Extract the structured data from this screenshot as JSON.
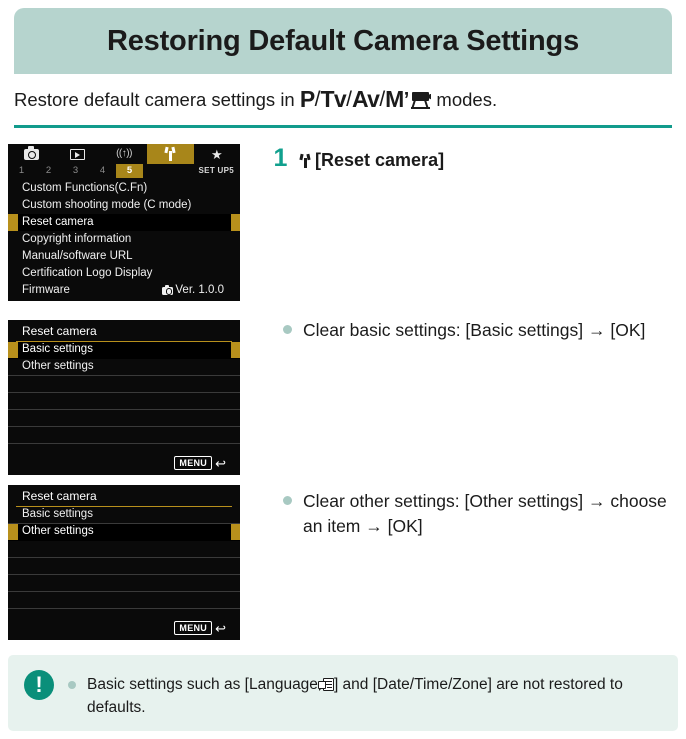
{
  "header": {
    "title": "Restoring Default Camera Settings"
  },
  "subtitle": {
    "prefix": "Restore default camera settings in ",
    "mode_p": "P",
    "mode_tv": "Tv",
    "mode_av": "Av",
    "mode_m": "M",
    "slash": "/",
    "apostrophe": "’",
    "movie_icon": "movie-camera-icon",
    "suffix": " modes."
  },
  "menu_screen_1": {
    "tabs": [
      {
        "icon": "shooting-camera-icon",
        "active": false
      },
      {
        "icon": "playback-icon",
        "active": false
      },
      {
        "icon": "wireless-icon",
        "label": "((↑))",
        "active": false
      },
      {
        "icon": "setup-wrench-icon",
        "active": true
      },
      {
        "icon": "my-menu-star-icon",
        "label": "★",
        "active": false
      }
    ],
    "page_numbers": [
      "1",
      "2",
      "3",
      "4",
      "5"
    ],
    "active_page": "5",
    "set_label": "SET UP5",
    "items": [
      {
        "label": "Custom Functions(C.Fn)",
        "selected": false,
        "value": ""
      },
      {
        "label": "Custom shooting mode (C mode)",
        "selected": false,
        "value": ""
      },
      {
        "label": "Reset camera",
        "selected": true,
        "value": ""
      },
      {
        "label": "Copyright information",
        "selected": false,
        "value": ""
      },
      {
        "label": "Manual/software URL",
        "selected": false,
        "value": ""
      },
      {
        "label": "Certification Logo Display",
        "selected": false,
        "value": ""
      },
      {
        "label": "Firmware",
        "selected": false,
        "value": "Ver. 1.0.0"
      }
    ]
  },
  "menu_screen_2": {
    "title": "Reset camera",
    "items": [
      {
        "label": "Basic settings",
        "selected": true
      },
      {
        "label": "Other settings",
        "selected": false
      }
    ],
    "blank_rows": 4,
    "menu_button": "MENU",
    "return_arrow": "↩"
  },
  "menu_screen_3": {
    "title": "Reset camera",
    "items": [
      {
        "label": "Basic settings",
        "selected": false
      },
      {
        "label": "Other settings",
        "selected": true
      }
    ],
    "blank_rows": 4,
    "menu_button": "MENU",
    "return_arrow": "↩"
  },
  "steps": [
    {
      "number": "1",
      "wrench_icon": "setup-wrench-icon",
      "text": "[Reset camera]"
    }
  ],
  "bullets": [
    {
      "text": "Clear basic settings: [Basic settings] → [OK]"
    },
    {
      "text": "Clear other settings: [Other settings] → choose an item → [OK]"
    }
  ],
  "caution": {
    "icon": "exclamation-icon",
    "icon_glyph": "!",
    "text_before": "Basic settings such as [Language",
    "language_glyph": "language-icon",
    "text_after": "] and [Date/Time/Zone] are not restored to defaults."
  },
  "colors": {
    "header_band": "#b6d4ce",
    "teal_rule": "#119b8c",
    "step_number": "#11a08e",
    "bullet_dot": "#a8c9c2",
    "menu_highlight": "#b8901c",
    "caution_bg": "#e7f2ee",
    "caution_icon": "#0a8f7a"
  }
}
